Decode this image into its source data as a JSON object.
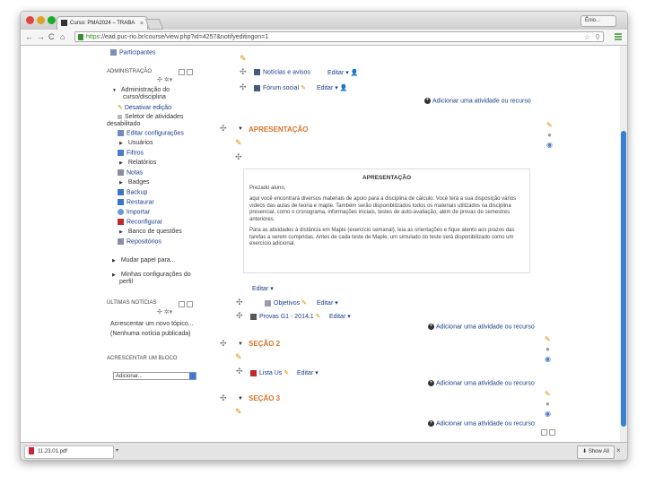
{
  "browser": {
    "tab_title": "Curso: PMA2024 – TRABA",
    "tab_close": "×",
    "user_label": "Ênio...",
    "url_https": "https",
    "url_rest": "://ead.puc-rio.br/course/view.php?id=4257&notifyeditingon=1",
    "back": "←",
    "forward": "→",
    "reload": "C",
    "home": "⌂",
    "star": "☆"
  },
  "sidebar": {
    "participants": "Participantes",
    "admin_heading": "ADMINISTRAÇÃO",
    "admin_items": [
      {
        "label": "Administração do",
        "label2": "curso/disciplina"
      },
      {
        "label": "Desativar edição"
      },
      {
        "label": "Seletor de atividades",
        "label2": "desabilitado"
      },
      {
        "label": "Editar configurações"
      },
      {
        "label": "Usuários"
      },
      {
        "label": "Filtros"
      },
      {
        "label": "Relatórios"
      },
      {
        "label": "Notas"
      },
      {
        "label": "Badges"
      },
      {
        "label": "Backup"
      },
      {
        "label": "Restaurar"
      },
      {
        "label": "Importar"
      },
      {
        "label": "Reconfigurar"
      },
      {
        "label": "Banco de questões"
      },
      {
        "label": "Repositórios"
      }
    ],
    "assume_role": "Mudar papel para...",
    "profile_settings": "Minhas configurações do",
    "profile_settings2": "perfil",
    "news_heading": "ÚLTIMAS NOTÍCIAS",
    "add_topic": "Acrescentar um novo tópico...",
    "no_news": "(Nenhuma notícia publicada)",
    "add_block_heading": "ACRESCENTAR UM BLOCO",
    "add_block_select": "Adicionar..."
  },
  "main": {
    "edit_label": "Editar",
    "news_forum": "Notícias e avisos",
    "social_forum": "Fórum social",
    "add_activity": "Adicionar uma atividade ou recurso",
    "section1_title": "APRESENTAÇÃO",
    "summary_title": "APRESENTAÇÃO",
    "summary_greeting": "Prezado aluno,",
    "summary_p1": "aqui você encontrará diversos materiais de apoio para a disciplina de cálculo. Você terá a sua disposição vários vídeos das aulas de teoria e maple. Também serão disponibilizados todos os materiais utilizados na disciplina presencial, como o cronograma, informações iniciais, testes de auto-avaliação, além de provas de semestres anteriores.",
    "summary_p2": "Para as atividades à distância em Maple (exercício semanal), leia as orientações e fique atento aos prazos das tarefas a serem cumpridas. Antes de cada teste de Maple, um simulado do teste será disponibilizado como um exercício adicional.",
    "objetivos": "Objetivos",
    "provas": "Provas G1 - 2014.1",
    "section2_title": "SEÇÃO 2",
    "lista": "Lista Us",
    "section3_title": "SEÇÃO 3"
  },
  "downloads": {
    "file": "11.23.01.pdf",
    "show_all": "Show All",
    "close": "×"
  }
}
